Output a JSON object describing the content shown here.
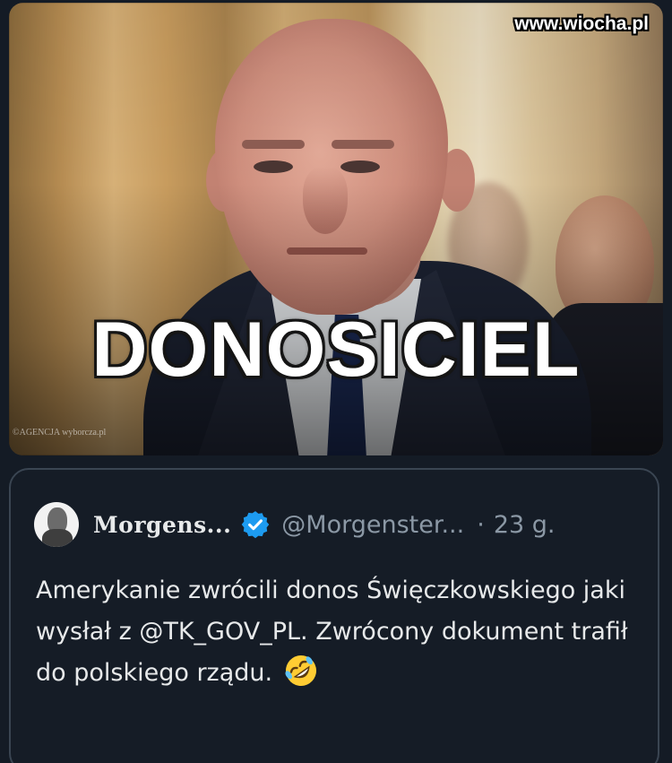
{
  "image": {
    "headline": "DONOSICIEL",
    "photo_credit": "©AGENCJA wyborcza.pl",
    "watermark": "www.wiocha.pl"
  },
  "quoted_tweet": {
    "author_name": "Morgens...",
    "handle": "@Morgenster...",
    "separator": "·",
    "time": "23 g.",
    "text": "Amerykanie zwrócili donos Święczkowskiego jaki wysłał z @TK_GOV_PL. Zwrócony dokument trafił do polskiego rządu.",
    "emoji_icon": "rolling-on-floor-laughing-emoji",
    "verified_color": "#1d9bf0"
  },
  "colors": {
    "background": "#141b25",
    "card_border": "#3a4552",
    "primary_text": "#e7e9ea",
    "secondary_text": "#8b98a5"
  }
}
